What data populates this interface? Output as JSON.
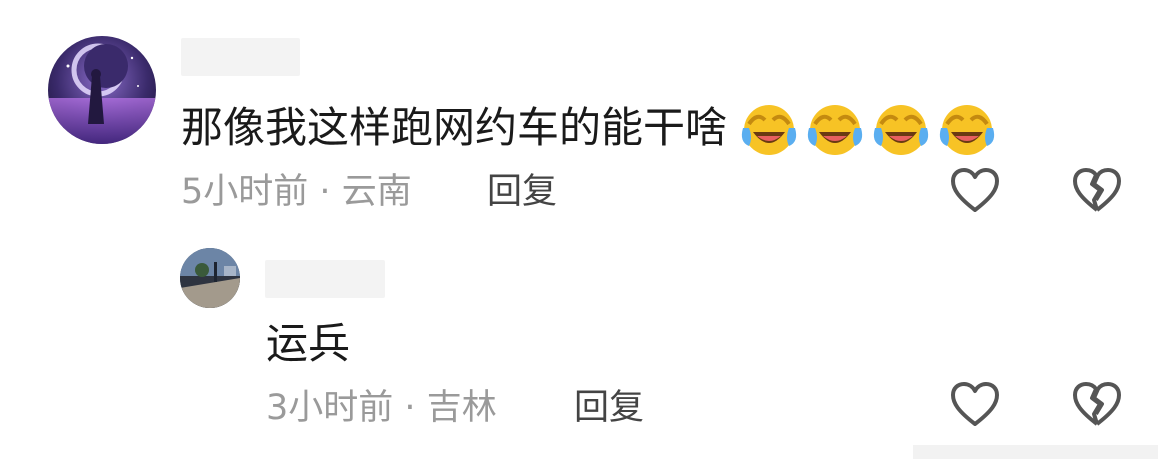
{
  "comments": [
    {
      "text": "那像我这样跑网约车的能干啥",
      "time": "5小时前",
      "separator": "·",
      "location": "云南",
      "reply_label": "回复",
      "emoji": [
        "laughing-crying-emoji",
        "laughing-crying-emoji",
        "laughing-crying-emoji",
        "laughing-crying-emoji"
      ]
    },
    {
      "text": "运兵",
      "time": "3小时前",
      "separator": "·",
      "location": "吉林",
      "reply_label": "回复"
    }
  ],
  "icons": {
    "like": "heart-outline-icon",
    "dislike": "broken-heart-icon"
  },
  "colors": {
    "text": "#1a1a1a",
    "meta": "#9a9a9a",
    "reply": "#444444",
    "icon": "#555555"
  }
}
